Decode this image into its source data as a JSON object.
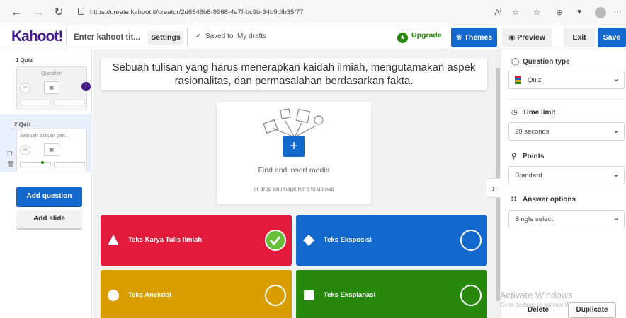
{
  "browser": {
    "url": "https://create.kahoot.it/creator/2d6546b8-9968-4a7f-bc9b-34b9dfb35f77",
    "back_icon": "arrow-left-icon",
    "forward_icon": "arrow-right-icon",
    "refresh_icon": "refresh-icon",
    "more": "···"
  },
  "header": {
    "logo": "Kahoot!",
    "title_placeholder": "Enter kahoot tit...",
    "settings_label": "Settings",
    "saved_text": "Saved to: My drafts",
    "upgrade_label": "Upgrade",
    "themes_label": "Themes",
    "preview_label": "Preview",
    "exit_label": "Exit",
    "save_label": "Save"
  },
  "sidebar": {
    "slides": [
      {
        "label": "1  Quiz",
        "preview": "Question",
        "time": "20"
      },
      {
        "label": "2  Quiz",
        "preview": "Sebuah tulisan yan...",
        "time": "20"
      }
    ],
    "add_question": "Add question",
    "add_slide": "Add slide"
  },
  "editor": {
    "question": "Sebuah tulisan yang harus menerapkan kaidah ilmiah, mengutamakan aspek rasionalitas, dan permasalahan berdasarkan fakta.",
    "media_plus": "+",
    "find_media": "Find and insert media",
    "drop_media": "or drop an image here to upload",
    "answers": [
      {
        "text": "Teks Karya Tulis Ilmiah",
        "color": "#e21b3c",
        "shape": "triangle",
        "correct": true
      },
      {
        "text": "Teks Eksposisi",
        "color": "#1368ce",
        "shape": "diamond",
        "correct": false
      },
      {
        "text": "Teks Anekdot",
        "color": "#d89e00",
        "shape": "circle",
        "correct": false
      },
      {
        "text": "Teks Eksplanasi",
        "color": "#26890c",
        "shape": "square",
        "correct": false
      }
    ]
  },
  "right_panel": {
    "question_type_label": "Question type",
    "question_type_value": "Quiz",
    "time_limit_label": "Time limit",
    "time_limit_value": "20 seconds",
    "points_label": "Points",
    "points_value": "Standard",
    "answer_options_label": "Answer options",
    "answer_options_value": "Single select",
    "delete_label": "Delete",
    "duplicate_label": "Duplicate"
  },
  "watermark": {
    "line1": "Activate Windows",
    "line2": "Go to Settings to activate Windows."
  }
}
